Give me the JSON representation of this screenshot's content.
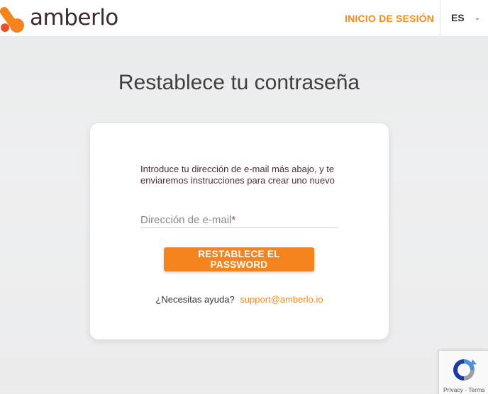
{
  "header": {
    "brand_name": "amberlo",
    "login_link": "INICIO DE SESIÓN",
    "language": "ES",
    "colors": {
      "accent": "#f28a1e",
      "brand_text": "#3d2a2e"
    }
  },
  "main": {
    "title": "Restablece tu contraseña",
    "intro": "Introduce tu dirección de e-mail más abajo, y te enviaremos instrucciones para crear uno nuevo",
    "email": {
      "label": "Dirección de e-mail",
      "required_mark": "*",
      "value": ""
    },
    "submit_label": "RESTABLECE EL PASSWORD",
    "help_text": "¿Necesitas ayuda?",
    "support_email": "support@amberlo.io"
  },
  "recaptcha": {
    "links": "Privacy - Terms",
    "icon": "recaptcha-icon"
  }
}
